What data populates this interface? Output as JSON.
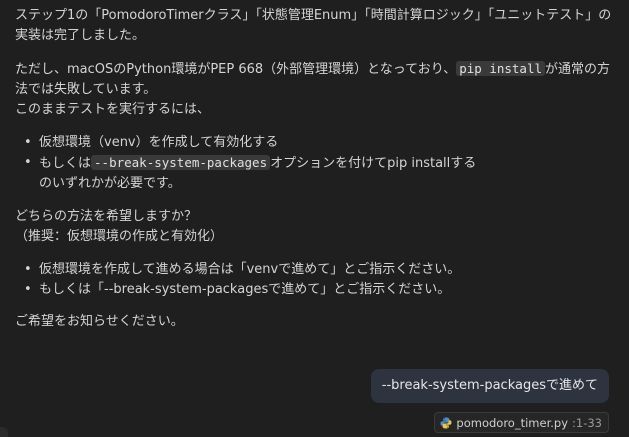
{
  "assistant": {
    "p1_line1": "ステップ1の「PomodoroTimerクラス」「状態管理Enum」「時間計算ロジック」「ユニットテスト」の",
    "p1_line2": "実装は完了しました。",
    "p2_line1_a": "ただし、macOSのPython環境がPEP 668（外部管理環境）となっており、",
    "p2_line1_code": "pip install",
    "p2_line1_b": "が通常の方",
    "p2_line2": "法では失敗しています。",
    "p2_line3": "このままテストを実行するには、",
    "options": [
      {
        "text_a": "仮想環境（venv）を作成して有効化する"
      },
      {
        "text_a": "もしくは",
        "code": "--break-system-packages",
        "text_b": "オプションを付けてpip installする"
      }
    ],
    "options_tail": "のいずれかが必要です。",
    "q_line1": "どちらの方法を希望しますか？",
    "q_line2": "（推奨：仮想環境の作成と有効化）",
    "instructions": [
      "仮想環境を作成して進める場合は「venvで進めて」とご指示ください。",
      "もしくは「--break-system-packagesで進めて」とご指示ください。"
    ],
    "closing": "ご希望をお知らせください。",
    "bullet": "•"
  },
  "user": {
    "message": "--break-system-packagesで進めて"
  },
  "file_chip": {
    "filename": "pomodoro_timer.py",
    "range": ":1-33",
    "icon": "python-icon"
  },
  "colors": {
    "background": "#1f1f1f",
    "text": "#d4d4d4",
    "user_bubble": "#2d3440",
    "inline_code_bg": "#3a3a3a"
  }
}
